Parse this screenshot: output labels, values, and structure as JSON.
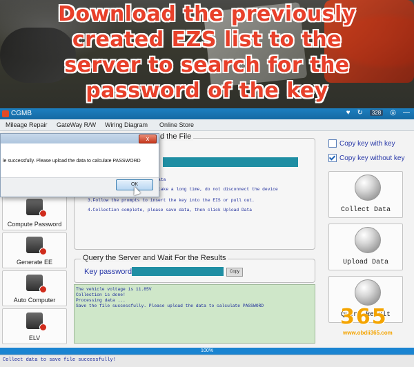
{
  "overlay": {
    "headline_lines": [
      "Download the previously",
      "created EZS list to the",
      "server to search for the",
      "password of the key"
    ]
  },
  "window": {
    "title": "CGMB",
    "status_badge": "328"
  },
  "menu": {
    "items": [
      "Mileage Repair",
      "GateWay R/W",
      "Wiring Diagram",
      "Online Store"
    ]
  },
  "sidebar": {
    "items": [
      {
        "label": "Compute Password",
        "icon": "laptop-icon"
      },
      {
        "label": "Generate EE",
        "icon": "key-device-icon"
      },
      {
        "label": "Auto Computer",
        "icon": "ecu-icon"
      },
      {
        "label": "ELV",
        "icon": "elv-icon"
      }
    ]
  },
  "collect_panel": {
    "title_visible": "d the File",
    "steps": [
      "ata",
      "take a long time, do not disconnect the device",
      "3.Follow the prompts to insert the key into the EIS or pull out.",
      "4.Collection complete, please save data, then click Upload Data"
    ]
  },
  "query_panel": {
    "title": "Query the Server and Wait For the Results",
    "key_label": "Key password",
    "copy_label": "Copy"
  },
  "log": {
    "lines": [
      "The vehicle voltage is 11.85V",
      "Collection is done!",
      "Processing data ...",
      "Save the file successfully. Please upload the data to calculate PASSWORD"
    ]
  },
  "options": {
    "copy_with_key": {
      "label": "Copy key with key",
      "checked": false
    },
    "copy_without_key": {
      "label": "Copy key without key",
      "checked": true
    }
  },
  "actions": {
    "collect": "Collect Data",
    "upload": "Upload  Data",
    "query": "Query Result"
  },
  "progress": {
    "text": "100%",
    "value": 100
  },
  "status": {
    "text": "Collect data to save file successfully!"
  },
  "dialog": {
    "message": "le successfully. Please upload the data to calculate PASSWORD",
    "ok_label": "OK",
    "close_label": "x"
  },
  "watermark": {
    "digits": "365",
    "url": "www.obdii365.com"
  },
  "colors": {
    "accent": "#1f8ea3",
    "title_bar": "#1d7fc0",
    "headline": "#e8402a",
    "log_bg": "#cfe7c9"
  }
}
